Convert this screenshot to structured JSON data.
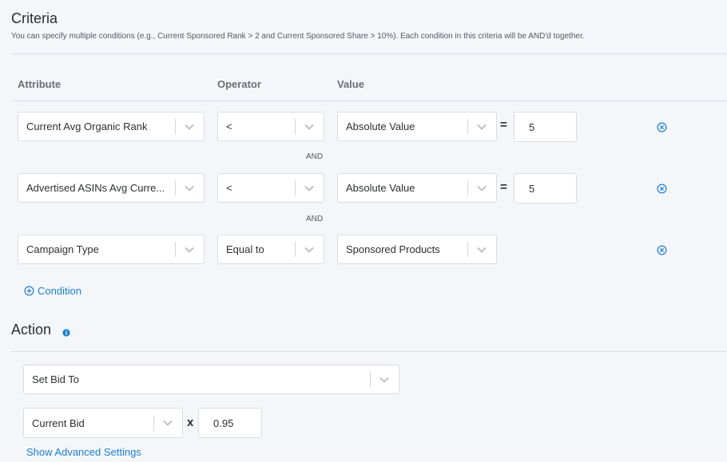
{
  "criteria": {
    "title": "Criteria",
    "subtitle": "You can specify multiple conditions (e.g., Current Sponsored Rank > 2 and Current Sponsored Share > 10%). Each condition in this criteria will be AND'd together.",
    "columns": {
      "attribute": "Attribute",
      "operator": "Operator",
      "value": "Value"
    },
    "conditions": [
      {
        "attribute": "Current Avg Organic Rank",
        "operator": "<",
        "value_type": "Absolute Value",
        "equals": "=",
        "value": "5"
      },
      {
        "attribute": "Advertised ASINs Avg Curre...",
        "operator": "<",
        "value_type": "Absolute Value",
        "equals": "=",
        "value": "5"
      },
      {
        "attribute": "Campaign Type",
        "operator": "Equal to",
        "value_type": "Sponsored Products"
      }
    ],
    "joiner": "AND",
    "add_condition_label": "Condition"
  },
  "action": {
    "title": "Action",
    "action_type": "Set Bid To",
    "base": "Current Bid",
    "multiply_symbol": "x",
    "multiplier": "0.95",
    "advanced_link": "Show Advanced Settings"
  },
  "colors": {
    "accent": "#1e7fd0",
    "background": "#f4f6fa",
    "border": "#d9dce2"
  },
  "icons": {
    "dropdown": "chevron-down-icon",
    "remove": "remove-circle-icon",
    "add": "add-circle-icon",
    "info": "info-icon"
  }
}
